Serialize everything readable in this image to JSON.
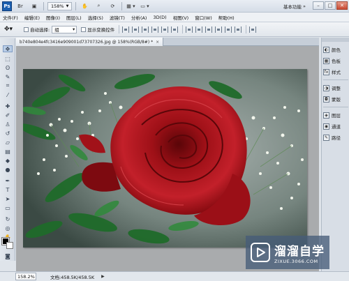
{
  "app": {
    "logo_text": "Ps",
    "zoom_value": "158%",
    "workspace_label": "基本功能",
    "window_controls": {
      "minimize": "–",
      "maximize": "□",
      "close": "✕"
    }
  },
  "menu": {
    "items": [
      "文件(F)",
      "编辑(E)",
      "图像(I)",
      "图层(L)",
      "选择(S)",
      "滤镜(T)",
      "分析(A)",
      "3D(D)",
      "视图(V)",
      "窗口(W)",
      "帮助(H)"
    ]
  },
  "options": {
    "auto_select_label": "自动选择:",
    "auto_select_value": "组",
    "show_transform_label": "显示变换控件"
  },
  "document": {
    "tab_title": "b740e804e4fc3416e909001d73707326.jpg @ 158%(RGB/8#) *",
    "tab_close": "×"
  },
  "status": {
    "zoom": "158.2%",
    "doc_info": "文档:458.5K/458.5K",
    "arrow": "▶"
  },
  "panels": {
    "items": [
      {
        "label": "颜色",
        "icon": "color-swatch-icon"
      },
      {
        "label": "色板",
        "icon": "swatches-icon"
      },
      {
        "label": "样式",
        "icon": "styles-icon"
      },
      {
        "label": "调整",
        "icon": "adjustments-icon"
      },
      {
        "label": "蒙版",
        "icon": "masks-icon"
      },
      {
        "label": "图层",
        "icon": "layers-icon"
      },
      {
        "label": "通道",
        "icon": "channels-icon"
      },
      {
        "label": "路径",
        "icon": "paths-icon"
      }
    ]
  },
  "watermark": {
    "title": "溜溜自学",
    "subtitle": "ZIXUE.3066.COM"
  },
  "colors": {
    "foreground": "#000000",
    "background": "#ffffff",
    "rose": "#b3121a",
    "accent": "#1c5fb0"
  }
}
